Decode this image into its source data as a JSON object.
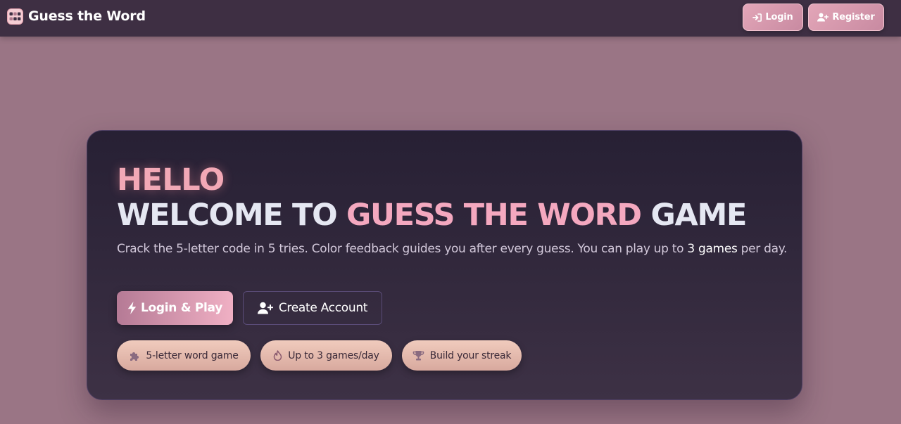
{
  "navbar": {
    "brand_title": "Guess the Word",
    "brand_icon": "game-tiles-icon",
    "login_label": "Login",
    "login_icon": "sign-in-icon",
    "register_label": "Register",
    "register_icon": "user-plus-icon"
  },
  "hero": {
    "hello": "HELLO",
    "welcome_prefix": "WELCOME TO",
    "welcome_accent": "GUESS THE WORD",
    "welcome_suffix": "GAME",
    "description_prefix": "Crack the 5-letter code in 5 tries. Color feedback guides you after every guess. You can play up to",
    "description_highlight": "3 games",
    "description_suffix": "per day.",
    "primary_button": "Login & Play",
    "primary_icon": "bolt-icon",
    "secondary_button": "Create Account",
    "secondary_icon": "user-plus-icon",
    "pills": [
      {
        "label": "5-letter word game",
        "icon": "puzzle-icon"
      },
      {
        "label": "Up to 3 games/day",
        "icon": "fire-icon"
      },
      {
        "label": "Build your streak",
        "icon": "trophy-icon"
      }
    ]
  },
  "colors": {
    "page_background": "#9a7585",
    "navbar": "#3e2f43",
    "hero_card": "#2c2438",
    "accent_pink": "#f4a8bf",
    "hello": "#f2a8b6"
  }
}
